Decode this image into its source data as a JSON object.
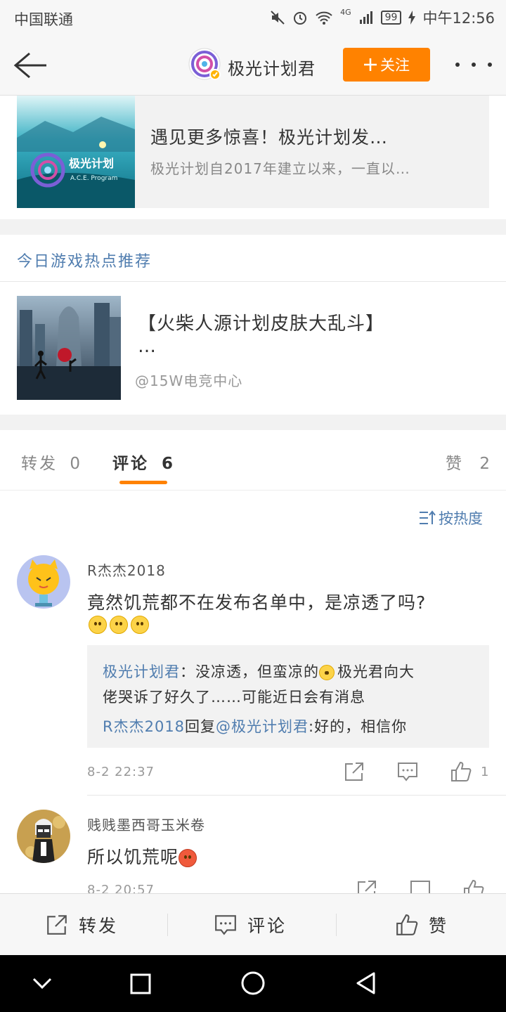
{
  "status": {
    "carrier": "中国联通",
    "battery": "99",
    "time": "中午12:56",
    "network": "4G"
  },
  "header": {
    "account_name": "极光计划君",
    "follow_label": "关注"
  },
  "linked_card": {
    "image_text": "极光计划",
    "image_subtext": "A.C.E. Program",
    "title": "遇见更多惊喜！极光计划发…",
    "desc": "极光计划自2017年建立以来，一直以…"
  },
  "recommend": {
    "section_title": "今日游戏热点推荐",
    "title": "【火柴人源计划皮肤大乱斗】",
    "title_overflow": "…",
    "source": "@15W电竞中心"
  },
  "tabs": [
    {
      "label": "转发",
      "count": "0"
    },
    {
      "label": "评论",
      "count": "6"
    },
    {
      "label": "赞",
      "count": "2"
    }
  ],
  "sort_label": "按热度",
  "comments": [
    {
      "author": "R杰杰2018",
      "text": "竟然饥荒都不在发布名单中，是凉透了吗?",
      "emojis": [
        "sad-emoji",
        "sad-emoji",
        "sad-emoji"
      ],
      "replies": [
        {
          "author": "极光计划君",
          "sep": "：",
          "text1": "没凉透，但蛮凉的",
          "text2": "极光君向大",
          "text3": "佬哭诉了好久了……可能近日会有消息"
        },
        {
          "author": "R杰杰2018",
          "mid": "回复",
          "mention": "@极光计划君",
          "text": ":好的，相信你"
        }
      ],
      "time": "8-2 22:37",
      "likes": "1"
    },
    {
      "author": "贱贱墨西哥玉米卷",
      "text": "所以饥荒呢",
      "emojis": [
        "angry-emoji"
      ],
      "time": "8-2 20:57"
    }
  ],
  "bottom_bar": {
    "repost": "转发",
    "comment": "评论",
    "like": "赞"
  },
  "colors": {
    "accent": "#ff8200",
    "link": "#507daf",
    "bg_gray": "#f2f2f2"
  }
}
